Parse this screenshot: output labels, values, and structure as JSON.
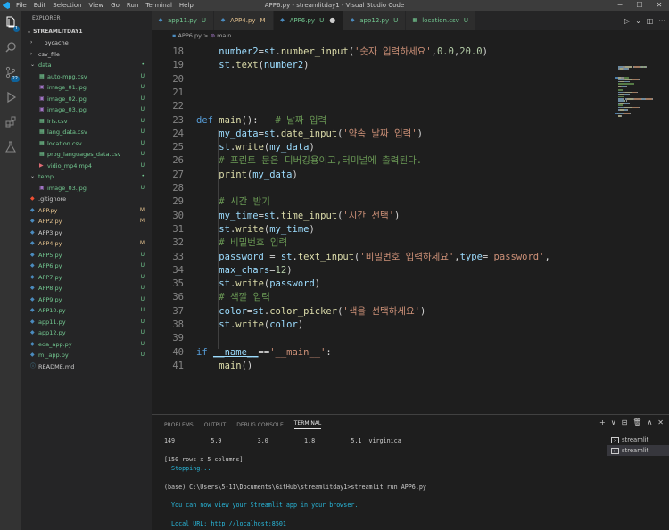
{
  "title_bar": {
    "menu": [
      "File",
      "Edit",
      "Selection",
      "View",
      "Go",
      "Run",
      "Terminal",
      "Help"
    ],
    "title": "APP6.py - streamlitday1 - Visual Studio Code",
    "min": "─",
    "max": "☐",
    "close": "✕"
  },
  "activity_bar": {
    "explorer_badge": "1",
    "source_control_badge": "22"
  },
  "sidebar": {
    "header": "EXPLORER",
    "folder": "STREAMLITDAY1",
    "items": [
      {
        "label": "__pycache__",
        "icon": "chevron-right",
        "indent": 1,
        "color": "#cccccc",
        "status": ""
      },
      {
        "label": "csv_file",
        "icon": "chevron-right",
        "indent": 1,
        "color": "#cccccc",
        "status": ""
      },
      {
        "label": "data",
        "icon": "chevron-down",
        "indent": 1,
        "color": "#73c991",
        "status": "•"
      },
      {
        "label": "auto-mpg.csv",
        "icon": "table",
        "indent": 2,
        "color": "#73c991",
        "status": "U"
      },
      {
        "label": "image_01.jpg",
        "icon": "image",
        "indent": 2,
        "color": "#73c991",
        "status": "U"
      },
      {
        "label": "image_02.jpg",
        "icon": "image",
        "indent": 2,
        "color": "#73c991",
        "status": "U"
      },
      {
        "label": "image_03.jpg",
        "icon": "image",
        "indent": 2,
        "color": "#73c991",
        "status": "U"
      },
      {
        "label": "iris.csv",
        "icon": "table",
        "indent": 2,
        "color": "#73c991",
        "status": "U"
      },
      {
        "label": "lang_data.csv",
        "icon": "table",
        "indent": 2,
        "color": "#73c991",
        "status": "U"
      },
      {
        "label": "location.csv",
        "icon": "table",
        "indent": 2,
        "color": "#73c991",
        "status": "U"
      },
      {
        "label": "prog_languages_data.csv",
        "icon": "table",
        "indent": 2,
        "color": "#73c991",
        "status": "U"
      },
      {
        "label": "vidio_mp4.mp4",
        "icon": "video",
        "indent": 2,
        "color": "#73c991",
        "status": "U"
      },
      {
        "label": "temp",
        "icon": "chevron-down",
        "indent": 1,
        "color": "#73c991",
        "status": "•"
      },
      {
        "label": "image_03.jpg",
        "icon": "image",
        "indent": 2,
        "color": "#73c991",
        "status": "U"
      },
      {
        "label": ".gitignore",
        "icon": "diamond",
        "indent": 1,
        "color": "#cccccc",
        "status": ""
      },
      {
        "label": "APP.py",
        "icon": "python",
        "indent": 1,
        "color": "#e2c08d",
        "status": "M"
      },
      {
        "label": "APP2.py",
        "icon": "python",
        "indent": 1,
        "color": "#e2c08d",
        "status": "M"
      },
      {
        "label": "APP3.py",
        "icon": "python",
        "indent": 1,
        "color": "#cccccc",
        "status": ""
      },
      {
        "label": "APP4.py",
        "icon": "python",
        "indent": 1,
        "color": "#e2c08d",
        "status": "M"
      },
      {
        "label": "APP5.py",
        "icon": "python",
        "indent": 1,
        "color": "#73c991",
        "status": "U"
      },
      {
        "label": "APP6.py",
        "icon": "python",
        "indent": 1,
        "color": "#73c991",
        "status": "U"
      },
      {
        "label": "APP7.py",
        "icon": "python",
        "indent": 1,
        "color": "#73c991",
        "status": "U"
      },
      {
        "label": "APP8.py",
        "icon": "python",
        "indent": 1,
        "color": "#73c991",
        "status": "U"
      },
      {
        "label": "APP9.py",
        "icon": "python",
        "indent": 1,
        "color": "#73c991",
        "status": "U"
      },
      {
        "label": "APP10.py",
        "icon": "python",
        "indent": 1,
        "color": "#73c991",
        "status": "U"
      },
      {
        "label": "app11.py",
        "icon": "python",
        "indent": 1,
        "color": "#73c991",
        "status": "U"
      },
      {
        "label": "app12.py",
        "icon": "python",
        "indent": 1,
        "color": "#73c991",
        "status": "U"
      },
      {
        "label": "eda_app.py",
        "icon": "python",
        "indent": 1,
        "color": "#73c991",
        "status": "U"
      },
      {
        "label": "ml_app.py",
        "icon": "python",
        "indent": 1,
        "color": "#73c991",
        "status": "U"
      },
      {
        "label": "README.md",
        "icon": "info",
        "indent": 1,
        "color": "#cccccc",
        "status": ""
      }
    ]
  },
  "tabs": [
    {
      "label": "app11.py",
      "mark": "U",
      "icon": "python",
      "active": false,
      "color": "#73c991"
    },
    {
      "label": "APP4.py",
      "mark": "M",
      "icon": "python",
      "active": false,
      "color": "#e2c08d"
    },
    {
      "label": "APP6.py",
      "mark": "U",
      "icon": "python",
      "active": true,
      "color": "#73c991"
    },
    {
      "label": "app12.py",
      "mark": "U",
      "icon": "python",
      "active": false,
      "color": "#73c991"
    },
    {
      "label": "location.csv",
      "mark": "U",
      "icon": "table",
      "active": false,
      "color": "#73c991"
    }
  ],
  "breadcrumb": {
    "file": "APP6.py",
    "separator": ">",
    "symbol": "main"
  },
  "code_lines": [
    {
      "n": "18",
      "tokens": [
        [
          "    ",
          ""
        ],
        [
          "number2",
          "var"
        ],
        [
          "=",
          ""
        ],
        [
          "st",
          "var"
        ],
        [
          ".",
          ""
        ],
        [
          "number_input",
          "fn"
        ],
        [
          "(",
          ""
        ],
        [
          "'숫자 입력하세요'",
          "str"
        ],
        [
          ",",
          ""
        ],
        [
          "0.0",
          "numv"
        ],
        [
          ",",
          ""
        ],
        [
          "20.0",
          "numv"
        ],
        [
          ")",
          ""
        ]
      ]
    },
    {
      "n": "19",
      "tokens": [
        [
          "    ",
          ""
        ],
        [
          "st",
          "var"
        ],
        [
          ".",
          ""
        ],
        [
          "text",
          "fn"
        ],
        [
          "(",
          ""
        ],
        [
          "number2",
          "var"
        ],
        [
          ")",
          ""
        ]
      ]
    },
    {
      "n": "20",
      "tokens": []
    },
    {
      "n": "21",
      "tokens": []
    },
    {
      "n": "22",
      "tokens": []
    },
    {
      "n": "23",
      "tokens": [
        [
          "def ",
          "kw"
        ],
        [
          "main",
          "fn"
        ],
        [
          "():   ",
          ""
        ],
        [
          "# 날짜 입력",
          "cm"
        ]
      ]
    },
    {
      "n": "24",
      "tokens": [
        [
          "    ",
          ""
        ],
        [
          "my_data",
          "var"
        ],
        [
          "=",
          ""
        ],
        [
          "st",
          "var"
        ],
        [
          ".",
          ""
        ],
        [
          "date_input",
          "fn"
        ],
        [
          "(",
          ""
        ],
        [
          "'약속 날짜 입력'",
          "str"
        ],
        [
          ")",
          ""
        ]
      ]
    },
    {
      "n": "25",
      "tokens": [
        [
          "    ",
          ""
        ],
        [
          "st",
          "var"
        ],
        [
          ".",
          ""
        ],
        [
          "write",
          "fn"
        ],
        [
          "(",
          ""
        ],
        [
          "my_data",
          "var"
        ],
        [
          ")",
          ""
        ]
      ]
    },
    {
      "n": "26",
      "tokens": [
        [
          "    ",
          ""
        ],
        [
          "# 프린트 문은 디버깅용이고,터미널에 출력된다.",
          "cm"
        ]
      ]
    },
    {
      "n": "27",
      "tokens": [
        [
          "    ",
          ""
        ],
        [
          "print",
          "fn"
        ],
        [
          "(",
          ""
        ],
        [
          "my_data",
          "var"
        ],
        [
          ")",
          ""
        ]
      ]
    },
    {
      "n": "28",
      "tokens": []
    },
    {
      "n": "29",
      "tokens": [
        [
          "    ",
          ""
        ],
        [
          "# 시간 받기",
          "cm"
        ]
      ]
    },
    {
      "n": "30",
      "tokens": [
        [
          "    ",
          ""
        ],
        [
          "my_time",
          "var"
        ],
        [
          "=",
          ""
        ],
        [
          "st",
          "var"
        ],
        [
          ".",
          ""
        ],
        [
          "time_input",
          "fn"
        ],
        [
          "(",
          ""
        ],
        [
          "'시간 선택'",
          "str"
        ],
        [
          ")",
          ""
        ]
      ]
    },
    {
      "n": "31",
      "tokens": [
        [
          "    ",
          ""
        ],
        [
          "st",
          "var"
        ],
        [
          ".",
          ""
        ],
        [
          "write",
          "fn"
        ],
        [
          "(",
          ""
        ],
        [
          "my_time",
          "var"
        ],
        [
          ")",
          ""
        ]
      ]
    },
    {
      "n": "32",
      "tokens": [
        [
          "    ",
          ""
        ],
        [
          "# 비밀번호 입력",
          "cm"
        ]
      ]
    },
    {
      "n": "33",
      "tokens": [
        [
          "    ",
          ""
        ],
        [
          "password",
          "var"
        ],
        [
          " = ",
          ""
        ],
        [
          "st",
          "var"
        ],
        [
          ".",
          ""
        ],
        [
          "text_input",
          "fn"
        ],
        [
          "(",
          ""
        ],
        [
          "'비밀번호 입력하세요'",
          "str"
        ],
        [
          ",",
          ""
        ],
        [
          "type",
          "var"
        ],
        [
          "=",
          ""
        ],
        [
          "'password'",
          "str"
        ],
        [
          ",",
          ""
        ]
      ]
    },
    {
      "n": "34",
      "tokens": [
        [
          "    ",
          ""
        ],
        [
          "max_chars",
          "var"
        ],
        [
          "=",
          ""
        ],
        [
          "12",
          "numv"
        ],
        [
          ")",
          ""
        ]
      ]
    },
    {
      "n": "35",
      "tokens": [
        [
          "    ",
          ""
        ],
        [
          "st",
          "var"
        ],
        [
          ".",
          ""
        ],
        [
          "write",
          "fn"
        ],
        [
          "(",
          ""
        ],
        [
          "password",
          "var"
        ],
        [
          ")",
          ""
        ]
      ]
    },
    {
      "n": "36",
      "tokens": [
        [
          "    ",
          ""
        ],
        [
          "# 색깔 입력",
          "cm"
        ]
      ]
    },
    {
      "n": "37",
      "tokens": [
        [
          "    ",
          ""
        ],
        [
          "color",
          "var"
        ],
        [
          "=",
          ""
        ],
        [
          "st",
          "var"
        ],
        [
          ".",
          ""
        ],
        [
          "color_picker",
          "fn"
        ],
        [
          "(",
          ""
        ],
        [
          "'색을 선택하세요'",
          "str"
        ],
        [
          ")",
          ""
        ]
      ]
    },
    {
      "n": "38",
      "tokens": [
        [
          "    ",
          ""
        ],
        [
          "st",
          "var"
        ],
        [
          ".",
          ""
        ],
        [
          "write",
          "fn"
        ],
        [
          "(",
          ""
        ],
        [
          "color",
          "var"
        ],
        [
          ")",
          ""
        ]
      ]
    },
    {
      "n": "39",
      "tokens": []
    },
    {
      "n": "40",
      "tokens": [
        [
          "if ",
          "kw"
        ],
        [
          "__name__",
          "dunder"
        ],
        [
          "==",
          ""
        ],
        [
          "'__main__'",
          "str"
        ],
        [
          ":",
          ""
        ]
      ]
    },
    {
      "n": "41",
      "tokens": [
        [
          "    ",
          ""
        ],
        [
          "main",
          "fn"
        ],
        [
          "()",
          ""
        ]
      ]
    }
  ],
  "panel": {
    "tabs": [
      "PROBLEMS",
      "OUTPUT",
      "DEBUG CONSOLE",
      "TERMINAL"
    ],
    "active_tab": "TERMINAL",
    "actions": [
      "+",
      "∨",
      "⊟",
      "🗑",
      "∧",
      "✕"
    ],
    "terminal_lines": [
      {
        "text": "149          5.9          3.0          1.8          5.1  virginica",
        "cls": ""
      },
      {
        "text": "",
        "cls": ""
      },
      {
        "text": "[150 rows x 5 columns]",
        "cls": ""
      },
      {
        "text": "  Stopping...",
        "cls": "tcyan"
      },
      {
        "text": "",
        "cls": ""
      },
      {
        "text": "(base) C:\\Users\\5-11\\Documents\\GitHub\\streamlitday1>streamlit run APP6.py",
        "cls": ""
      },
      {
        "text": "",
        "cls": ""
      },
      {
        "text": "  You can now view your Streamlit app in your browser.",
        "cls": "tcyan"
      },
      {
        "text": "",
        "cls": ""
      },
      {
        "text": "  Local URL: http://localhost:8501",
        "cls": "tcyan"
      }
    ],
    "terminals": [
      {
        "label": "streamlit",
        "active": false
      },
      {
        "label": "streamlit",
        "active": true
      }
    ]
  },
  "colors": {
    "untracked": "#73c991",
    "modified": "#e2c08d",
    "accent": "#0e639c"
  }
}
